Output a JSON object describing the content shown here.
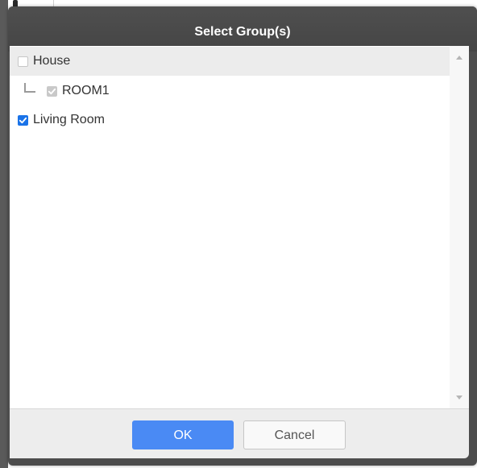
{
  "dialog": {
    "title": "Select Group(s)"
  },
  "tree": {
    "items": [
      {
        "label": "House",
        "checked": false,
        "disabled": false,
        "level": 0
      },
      {
        "label": "ROOM1",
        "checked": true,
        "disabled": true,
        "level": 1
      },
      {
        "label": "Living Room",
        "checked": true,
        "disabled": false,
        "level": 0
      }
    ]
  },
  "footer": {
    "ok_label": "OK",
    "cancel_label": "Cancel"
  },
  "colors": {
    "header": "#4d4d4d",
    "ok_button": "#4a8af4",
    "checkbox_checked": "#1a73e8",
    "checkbox_disabled": "#c9c9c9",
    "selected_row": "#ececec"
  }
}
